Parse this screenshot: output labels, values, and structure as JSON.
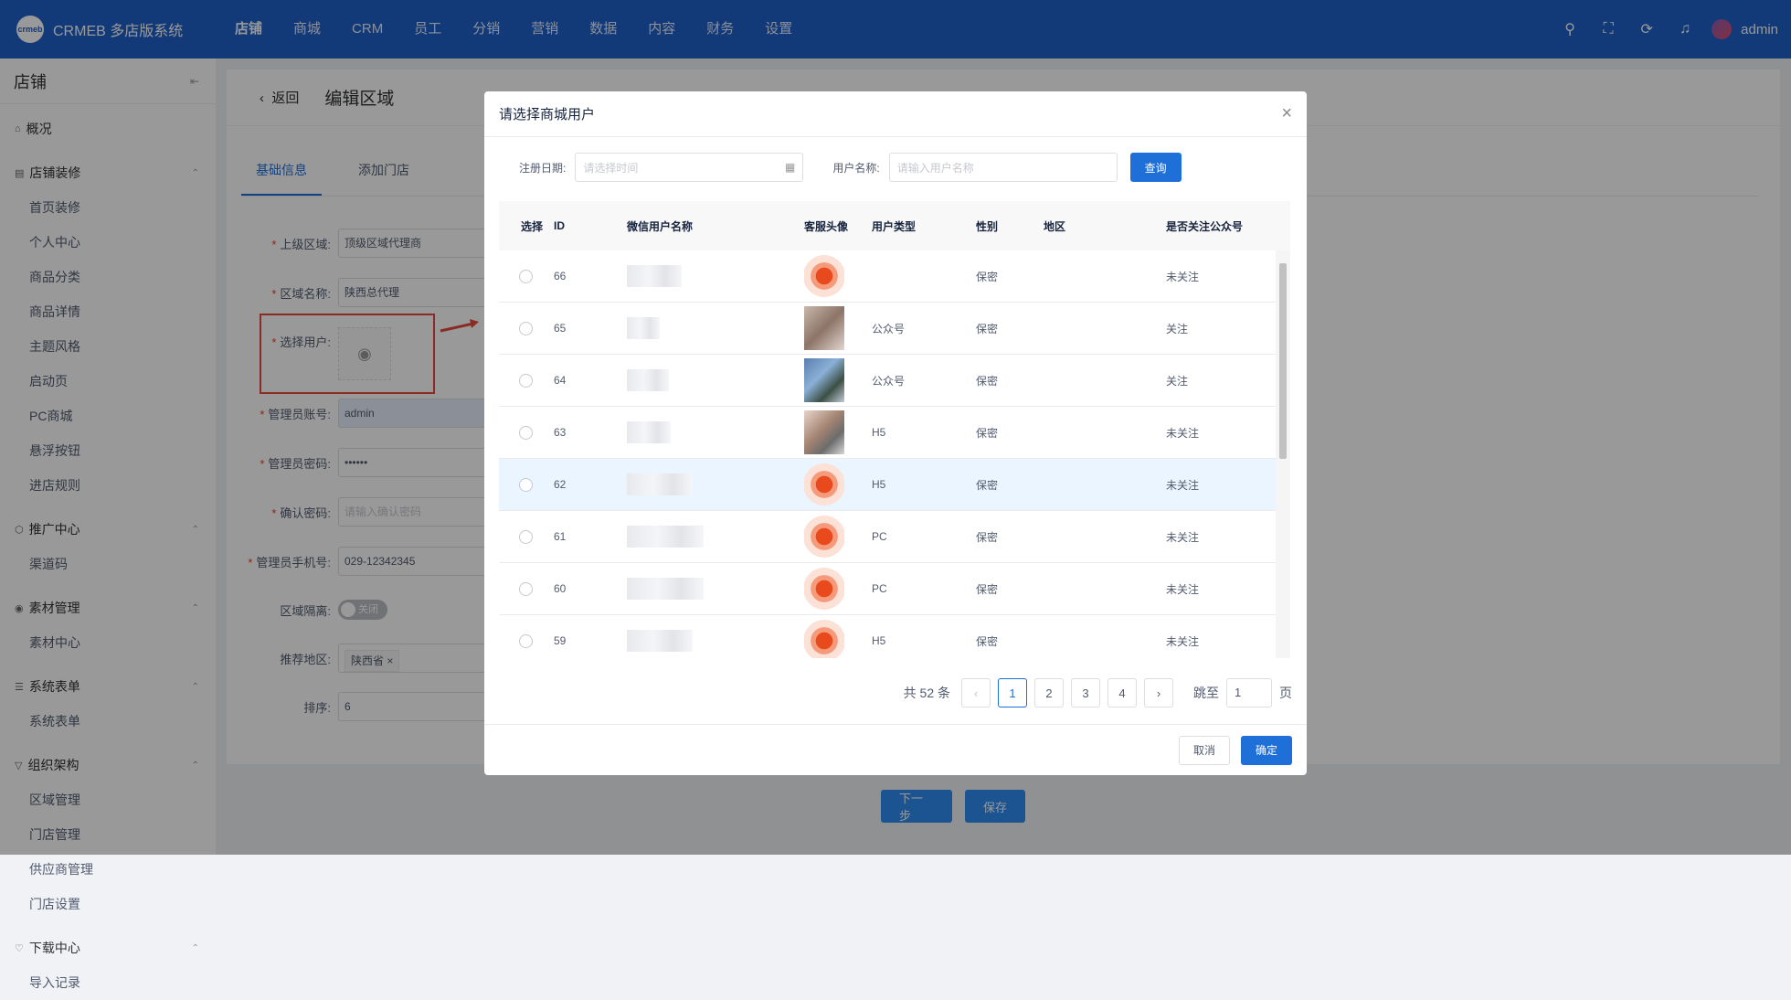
{
  "brand": {
    "name": "CRMEB 多店版系统",
    "logo_text": "crmeb"
  },
  "topnav": [
    "店铺",
    "商城",
    "CRM",
    "员工",
    "分销",
    "营销",
    "数据",
    "内容",
    "财务",
    "设置"
  ],
  "user": {
    "name": "admin"
  },
  "sidebar": {
    "title": "店铺",
    "overview": "概况",
    "groups": [
      {
        "label": "店铺装修",
        "items": [
          "首页装修",
          "个人中心",
          "商品分类",
          "商品详情",
          "主题风格",
          "启动页",
          "PC商城",
          "悬浮按钮",
          "进店规则"
        ]
      },
      {
        "label": "推广中心",
        "items": [
          "渠道码"
        ]
      },
      {
        "label": "素材管理",
        "items": [
          "素材中心"
        ]
      },
      {
        "label": "系统表单",
        "items": [
          "系统表单"
        ]
      },
      {
        "label": "组织架构",
        "items": [
          "区域管理",
          "门店管理",
          "供应商管理",
          "门店设置"
        ]
      },
      {
        "label": "下载中心",
        "items": [
          "导入记录"
        ]
      }
    ]
  },
  "page": {
    "back": "返回",
    "title": "编辑区域",
    "tabs": [
      "基础信息",
      "添加门店"
    ],
    "form": {
      "parent_label": "上级区域:",
      "parent_value": "顶级区域代理商",
      "name_label": "区域名称:",
      "name_value": "陕西总代理",
      "user_label": "选择用户:",
      "account_label": "管理员账号:",
      "account_value": "admin",
      "pwd_label": "管理员密码:",
      "pwd_value": "••••••",
      "confirm_label": "确认密码:",
      "confirm_placeholder": "请输入确认密码",
      "phone_label": "管理员手机号:",
      "phone_value": "029-12342345",
      "isolate_label": "区域隔离:",
      "isolate_value": "关闭",
      "recommend_label": "推荐地区:",
      "recommend_tag": "陕西省",
      "sort_label": "排序:",
      "sort_value": "6"
    },
    "next_label": "下一步",
    "save_label": "保存"
  },
  "dialog": {
    "title": "请选择商城用户",
    "filter": {
      "date_label": "注册日期:",
      "date_placeholder": "请选择时间",
      "name_label": "用户名称:",
      "name_placeholder": "请输入用户名称",
      "query_label": "查询"
    },
    "columns": [
      "选择",
      "ID",
      "微信用户名称",
      "客服头像",
      "用户类型",
      "性别",
      "地区",
      "是否关注公众号"
    ],
    "rows": [
      {
        "id": "66",
        "type": "",
        "gender": "保密",
        "region": "",
        "follow": "未关注",
        "avatar": "a"
      },
      {
        "id": "65",
        "type": "公众号",
        "gender": "保密",
        "region": "",
        "follow": "关注",
        "avatar": "b"
      },
      {
        "id": "64",
        "type": "公众号",
        "gender": "保密",
        "region": "",
        "follow": "关注",
        "avatar": "c"
      },
      {
        "id": "63",
        "type": "H5",
        "gender": "保密",
        "region": "",
        "follow": "未关注",
        "avatar": "d"
      },
      {
        "id": "62",
        "type": "H5",
        "gender": "保密",
        "region": "",
        "follow": "未关注",
        "avatar": "a"
      },
      {
        "id": "61",
        "type": "PC",
        "gender": "保密",
        "region": "",
        "follow": "未关注",
        "avatar": "a"
      },
      {
        "id": "60",
        "type": "PC",
        "gender": "保密",
        "region": "",
        "follow": "未关注",
        "avatar": "a"
      },
      {
        "id": "59",
        "type": "H5",
        "gender": "保密",
        "region": "",
        "follow": "未关注",
        "avatar": "a"
      }
    ],
    "pagination": {
      "total": "共 52 条",
      "pages": [
        "1",
        "2",
        "3",
        "4"
      ],
      "current": "1",
      "jump_label": "跳至",
      "jump_value": "1",
      "page_unit": "页"
    },
    "cancel_label": "取消",
    "ok_label": "确定"
  },
  "colors": {
    "topbar": "#1f5fc8",
    "primary": "#1f6fd8",
    "highlight": "#e8483b"
  }
}
